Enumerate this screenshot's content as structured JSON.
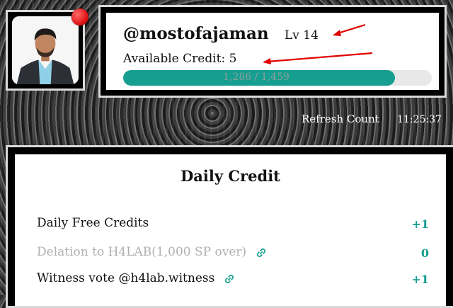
{
  "profile": {
    "username": "@mostofajaman",
    "level": "Lv 14",
    "credit_text": "Available Credit: 5",
    "progress_text": "1,286 / 1,459",
    "progress_current": 1286,
    "progress_max": 1459
  },
  "refresh": {
    "label": "Refresh Count",
    "time": "11:25:37"
  },
  "daily": {
    "title": "Daily Credit",
    "rows": [
      {
        "label": "Daily Free Credits",
        "value": "+1",
        "muted": false,
        "link": false
      },
      {
        "label": "Delation to H4LAB(1,000 SP over)",
        "value": "0",
        "muted": true,
        "link": true
      },
      {
        "label": "Witness vote @h4lab.witness",
        "value": "+1",
        "muted": false,
        "link": true
      }
    ]
  },
  "colors": {
    "accent": "#169e90",
    "notification": "#e01515",
    "annotation_arrow": "#e00000"
  },
  "icons": [
    "notification-dot",
    "link-icon",
    "annotation-arrow"
  ]
}
